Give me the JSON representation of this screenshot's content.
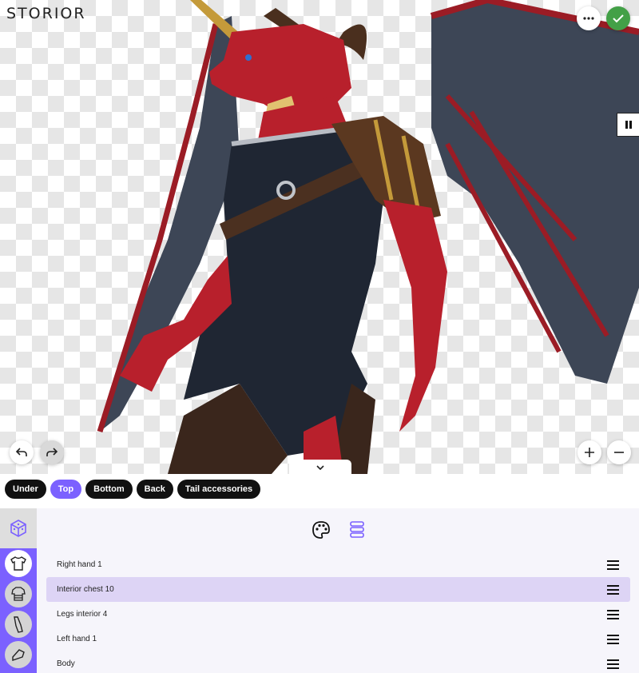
{
  "app": {
    "logo_text": "STORIOR"
  },
  "toolbar": {
    "more_icon": "more-horizontal-icon",
    "confirm_icon": "check-icon",
    "pause_icon": "pause-icon",
    "undo_icon": "undo-icon",
    "redo_icon": "redo-icon",
    "zoom_in_icon": "plus-icon",
    "zoom_out_icon": "minus-icon",
    "collapse_icon": "chevron-down-icon"
  },
  "categories": [
    {
      "label": "Under",
      "active": false
    },
    {
      "label": "Top",
      "active": true
    },
    {
      "label": "Bottom",
      "active": false
    },
    {
      "label": "Back",
      "active": false
    },
    {
      "label": "Tail accessories",
      "active": false
    }
  ],
  "sidebar": {
    "items": [
      {
        "icon": "dice-icon"
      },
      {
        "icon": "shirt-icon",
        "active": true
      },
      {
        "icon": "armor-icon"
      },
      {
        "icon": "glove-icon"
      },
      {
        "icon": "boot-icon"
      }
    ]
  },
  "panel_tools": {
    "palette_icon": "palette-icon",
    "layers_icon": "layers-icon"
  },
  "layers": [
    {
      "label": "Right hand 1",
      "highlight": false
    },
    {
      "label": "Interior chest 10",
      "highlight": true
    },
    {
      "label": "Legs interior 4",
      "highlight": false
    },
    {
      "label": "Left hand 1",
      "highlight": false
    },
    {
      "label": "Body",
      "highlight": false
    }
  ],
  "colors": {
    "accent": "#7b61ff",
    "confirm": "#43a047",
    "highlight_row": "#ddd4f5",
    "dragon_red": "#b8202c",
    "wing_membrane": "#3d4656"
  }
}
